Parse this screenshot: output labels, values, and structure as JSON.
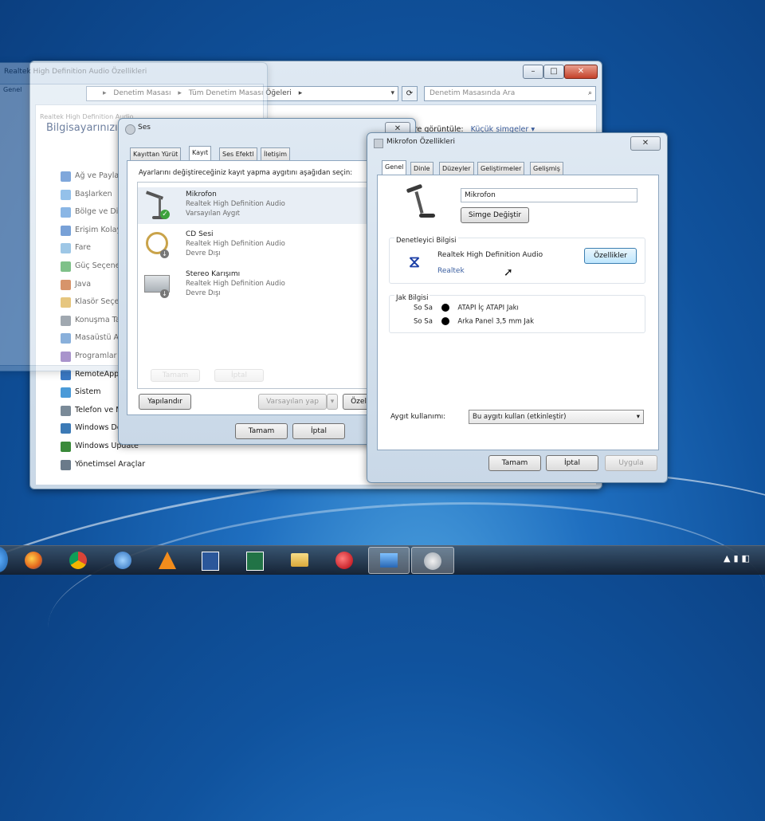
{
  "colors": {
    "desktop": "#1660b3",
    "taskbar": "#1b2a3c",
    "accent": "#3c7fb1"
  },
  "control_panel": {
    "address": [
      "Denetim Masası",
      "Tüm Denetim Masası Öğeleri"
    ],
    "search_placeholder": "Denetim Masasında Ara",
    "view_by_label": "göre görüntüle:",
    "view_by_value": "Küçük simgeler",
    "heading": "Bilgisayarınızın",
    "items": [
      "Ağ ve Paylaşım",
      "Başlarken",
      "Bölge ve Dil",
      "Erişim Kolaylığı",
      "Fare",
      "Güç Seçenekleri",
      "Java",
      "Klasör Seçenekleri",
      "Konuşma Tanıma",
      "Masaüstü Araçları",
      "Programlar ve",
      "RemoteApp ve",
      "Sistem",
      "Telefon ve Modem",
      "Windows Defender",
      "Windows Update",
      "Yönetimsel Araçlar"
    ]
  },
  "hd_audio": {
    "title": "Realtek High Definition Audio Özellikleri",
    "tab": "Genel",
    "device": "Realtek High Definition Audio"
  },
  "sound": {
    "title": "Ses",
    "tabs": [
      "Kayıttan Yürüt",
      "Kayıt",
      "Ses Efektl",
      "İletişim"
    ],
    "instruction": "Ayarlarını değiştireceğiniz kayıt yapma aygıtını aşağıdan seçin:",
    "devices": [
      {
        "name": "Mikrofon",
        "driver": "Realtek High Definition Audio",
        "status": "Varsayılan Aygıt"
      },
      {
        "name": "CD Sesi",
        "driver": "Realtek High Definition Audio",
        "status": "Devre Dışı"
      },
      {
        "name": "Stereo Karışımı",
        "driver": "Realtek High Definition Audio",
        "status": "Devre Dışı"
      }
    ],
    "configure_btn": "Yapılandır",
    "set_default_btn": "Varsayılan yap",
    "properties_btn": "Özellikler",
    "ok_btn": "Tamam",
    "cancel_btn": "İptal",
    "ghost_ok": "Tamam",
    "ghost_cancel": "İptal"
  },
  "mic_props": {
    "title": "Mikrofon Özellikleri",
    "tabs": [
      "Genel",
      "Dinle",
      "Düzeyler",
      "Geliştirmeler",
      "Gelişmiş"
    ],
    "name_value": "Mikrofon",
    "change_icon_btn": "Simge Değiştir",
    "controller_group": "Denetleyici Bilgisi",
    "controller_name": "Realtek High Definition Audio",
    "controller_vendor": "Realtek",
    "controller_props_btn": "Özellikler",
    "jack_group": "Jak Bilgisi",
    "jacks": [
      {
        "side": "So Sa",
        "desc": "ATAPI İç ATAPI Jakı"
      },
      {
        "side": "So Sa",
        "desc": "Arka Panel 3,5 mm Jak"
      }
    ],
    "usage_label": "Aygıt kullanımı:",
    "usage_value": "Bu aygıtı kullan (etkinleştir)",
    "ok_btn": "Tamam",
    "cancel_btn": "İptal",
    "apply_btn": "Uygula"
  },
  "taskbar": {
    "icons": [
      "firefox-icon",
      "chrome-icon",
      "network-icon",
      "vlc-icon",
      "word-icon",
      "excel-icon",
      "folder-icon",
      "red-app-icon",
      "control-panel-icon",
      "sound-icon"
    ]
  }
}
